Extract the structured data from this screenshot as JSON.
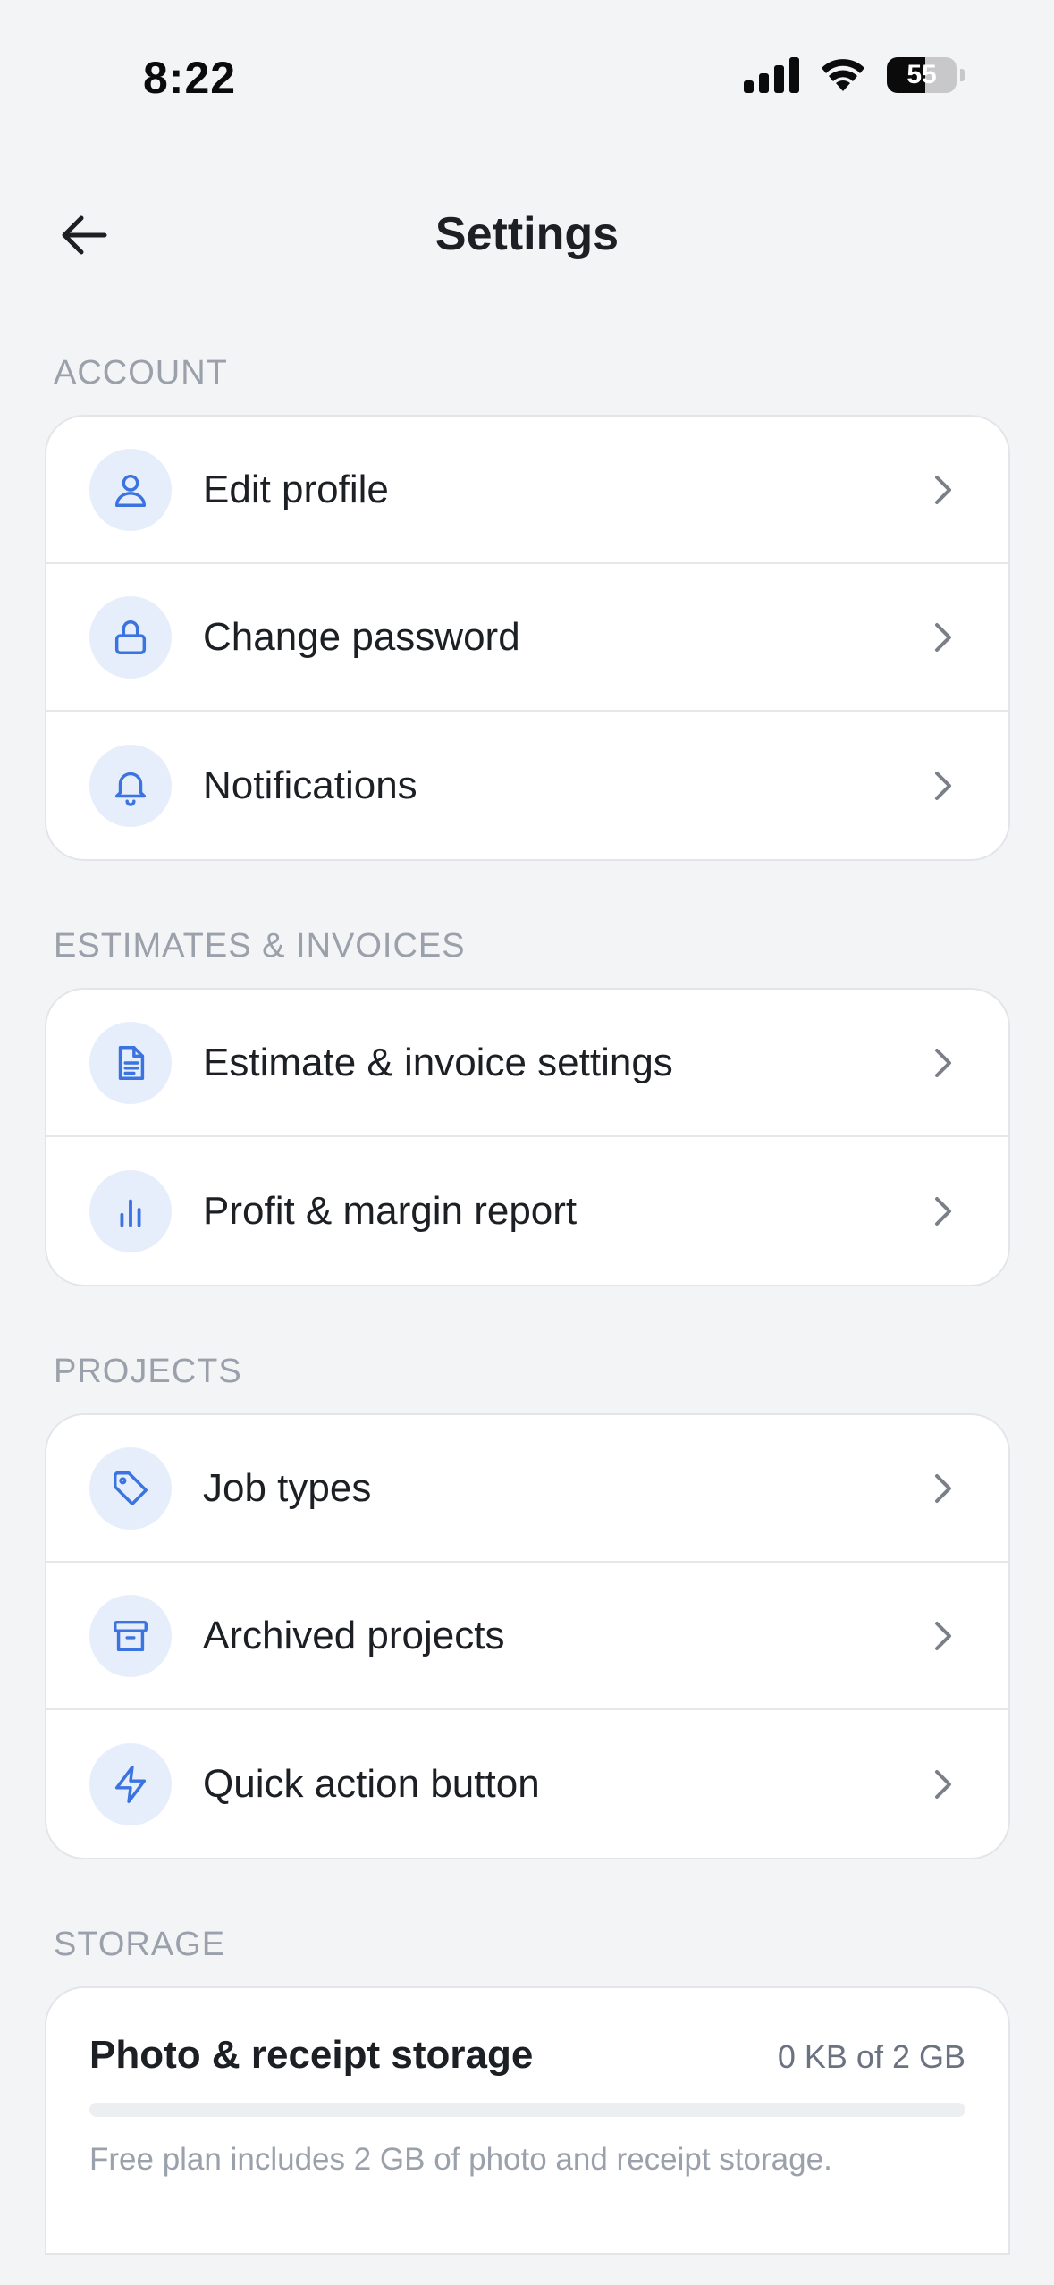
{
  "status_bar": {
    "time": "8:22",
    "battery_level": "55",
    "battery_fraction": 0.55
  },
  "header": {
    "title": "Settings"
  },
  "sections": {
    "account": {
      "label": "ACCOUNT",
      "items": [
        {
          "label": "Edit profile",
          "icon": "user-icon"
        },
        {
          "label": "Change password",
          "icon": "lock-icon"
        },
        {
          "label": "Notifications",
          "icon": "bell-icon"
        }
      ]
    },
    "estimates": {
      "label": "ESTIMATES & INVOICES",
      "items": [
        {
          "label": "Estimate & invoice settings",
          "icon": "document-icon"
        },
        {
          "label": "Profit & margin report",
          "icon": "bar-chart-icon"
        }
      ]
    },
    "projects": {
      "label": "PROJECTS",
      "items": [
        {
          "label": "Job types",
          "icon": "tag-icon"
        },
        {
          "label": "Archived projects",
          "icon": "archive-icon"
        },
        {
          "label": "Quick action button",
          "icon": "lightning-icon"
        }
      ]
    },
    "storage": {
      "label": "STORAGE",
      "title": "Photo & receipt storage",
      "usage": "0 KB of 2 GB",
      "used_fraction": 0,
      "note": "Free plan includes 2 GB of photo and receipt storage."
    }
  },
  "colors": {
    "accent": "#3b73e0",
    "icon_bg": "#e6eefb",
    "page_bg": "#f3f4f6",
    "muted": "#9aa1ab"
  }
}
